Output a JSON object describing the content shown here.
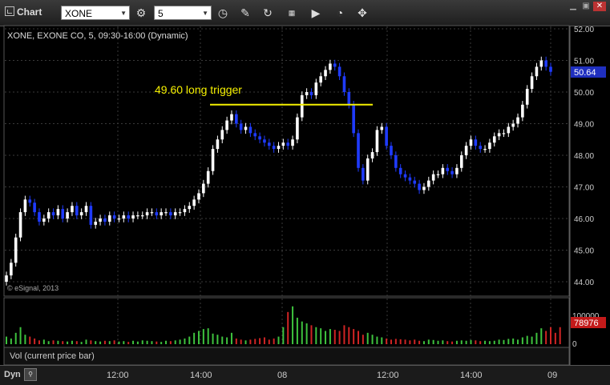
{
  "toolbar": {
    "title": "Chart",
    "symbol": "XONE",
    "interval": "5",
    "icons": [
      "clock-icon",
      "pencil-icon",
      "refresh-icon",
      "ecrt-icon",
      "play-icon",
      "calendar-icon",
      "draw-tools-icon"
    ]
  },
  "chart": {
    "header": "XONE, EXONE CO, 5, 09:30-16:00 (Dynamic)",
    "copyright": "© eSignal, 2013",
    "annotation": "49.60 long trigger",
    "price_labels": [
      "52.00",
      "51.00",
      "50.00",
      "49.00",
      "48.00",
      "47.00",
      "46.00",
      "45.00",
      "44.00"
    ],
    "last_price": "50.64",
    "volume_labels": [
      "100000",
      "0"
    ],
    "last_volume": "78976",
    "volume_study": "Vol (current price bar)"
  },
  "bottom": {
    "mode": "Dyn",
    "time_labels": [
      "12:00",
      "14:00",
      "08",
      "12:00",
      "14:00",
      "09"
    ]
  },
  "chart_data": {
    "type": "candlestick",
    "y_range": [
      44,
      52
    ],
    "trigger_level": 49.6,
    "closes": [
      44.2,
      44.6,
      45.4,
      46.2,
      46.6,
      46.5,
      46.2,
      45.9,
      46.0,
      46.2,
      46.1,
      46.3,
      46.0,
      46.2,
      46.4,
      46.1,
      46.2,
      46.4,
      45.8,
      45.9,
      46.0,
      45.9,
      46.1,
      46.0,
      46.0,
      46.1,
      46.0,
      46.1,
      46.1,
      46.1,
      46.2,
      46.2,
      46.1,
      46.2,
      46.2,
      46.1,
      46.2,
      46.2,
      46.3,
      46.4,
      46.6,
      46.8,
      47.1,
      47.5,
      48.2,
      48.5,
      48.8,
      49.1,
      49.3,
      49.0,
      48.8,
      48.9,
      48.7,
      48.6,
      48.5,
      48.4,
      48.3,
      48.2,
      48.3,
      48.4,
      48.3,
      48.5,
      49.2,
      49.9,
      50.0,
      49.9,
      50.3,
      50.5,
      50.7,
      50.9,
      50.8,
      50.5,
      50.0,
      49.6,
      48.7,
      47.6,
      47.2,
      47.9,
      48.1,
      48.8,
      48.9,
      48.3,
      48.0,
      47.6,
      47.4,
      47.3,
      47.2,
      47.1,
      46.9,
      47.0,
      47.2,
      47.4,
      47.4,
      47.6,
      47.5,
      47.4,
      47.6,
      48.0,
      48.3,
      48.5,
      48.3,
      48.2,
      48.2,
      48.4,
      48.6,
      48.7,
      48.7,
      48.9,
      49.0,
      49.2,
      49.6,
      50.1,
      50.5,
      50.8,
      51.0,
      50.8,
      50.64
    ],
    "volumes": [
      20000,
      15000,
      30000,
      45000,
      25000,
      20000,
      15000,
      10000,
      12000,
      8000,
      10000,
      9000,
      8000,
      7000,
      9000,
      8000,
      6000,
      12000,
      10000,
      8000,
      7000,
      9000,
      8000,
      10000,
      7000,
      8000,
      6000,
      9000,
      7000,
      10000,
      9000,
      8000,
      7000,
      6000,
      9000,
      8000,
      10000,
      12000,
      15000,
      20000,
      30000,
      35000,
      40000,
      42000,
      28000,
      25000,
      20000,
      18000,
      30000,
      15000,
      12000,
      10000,
      12000,
      14000,
      16000,
      18000,
      12000,
      15000,
      20000,
      45000,
      85000,
      100000,
      70000,
      60000,
      55000,
      50000,
      45000,
      42000,
      35000,
      40000,
      38000,
      35000,
      50000,
      45000,
      40000,
      35000,
      25000,
      30000,
      25000,
      20000,
      18000,
      15000,
      12000,
      14000,
      13000,
      12000,
      10000,
      12000,
      9000,
      8000,
      12000,
      11000,
      9000,
      10000,
      8000,
      7000,
      9000,
      10000,
      9000,
      11000,
      10000,
      8000,
      9000,
      8000,
      9000,
      12000,
      11000,
      14000,
      15000,
      12000,
      18000,
      22000,
      20000,
      30000,
      42000,
      35000,
      45000,
      30000,
      45000
    ]
  }
}
